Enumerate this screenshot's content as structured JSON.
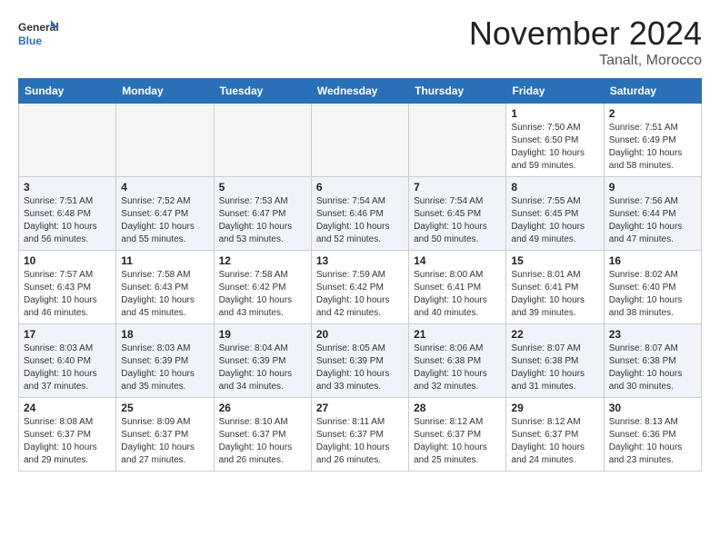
{
  "header": {
    "logo_general": "General",
    "logo_blue": "Blue",
    "month": "November 2024",
    "location": "Tanalt, Morocco"
  },
  "weekdays": [
    "Sunday",
    "Monday",
    "Tuesday",
    "Wednesday",
    "Thursday",
    "Friday",
    "Saturday"
  ],
  "weeks": [
    [
      {
        "day": "",
        "info": ""
      },
      {
        "day": "",
        "info": ""
      },
      {
        "day": "",
        "info": ""
      },
      {
        "day": "",
        "info": ""
      },
      {
        "day": "",
        "info": ""
      },
      {
        "day": "1",
        "info": "Sunrise: 7:50 AM\nSunset: 6:50 PM\nDaylight: 10 hours and 59 minutes."
      },
      {
        "day": "2",
        "info": "Sunrise: 7:51 AM\nSunset: 6:49 PM\nDaylight: 10 hours and 58 minutes."
      }
    ],
    [
      {
        "day": "3",
        "info": "Sunrise: 7:51 AM\nSunset: 6:48 PM\nDaylight: 10 hours and 56 minutes."
      },
      {
        "day": "4",
        "info": "Sunrise: 7:52 AM\nSunset: 6:47 PM\nDaylight: 10 hours and 55 minutes."
      },
      {
        "day": "5",
        "info": "Sunrise: 7:53 AM\nSunset: 6:47 PM\nDaylight: 10 hours and 53 minutes."
      },
      {
        "day": "6",
        "info": "Sunrise: 7:54 AM\nSunset: 6:46 PM\nDaylight: 10 hours and 52 minutes."
      },
      {
        "day": "7",
        "info": "Sunrise: 7:54 AM\nSunset: 6:45 PM\nDaylight: 10 hours and 50 minutes."
      },
      {
        "day": "8",
        "info": "Sunrise: 7:55 AM\nSunset: 6:45 PM\nDaylight: 10 hours and 49 minutes."
      },
      {
        "day": "9",
        "info": "Sunrise: 7:56 AM\nSunset: 6:44 PM\nDaylight: 10 hours and 47 minutes."
      }
    ],
    [
      {
        "day": "10",
        "info": "Sunrise: 7:57 AM\nSunset: 6:43 PM\nDaylight: 10 hours and 46 minutes."
      },
      {
        "day": "11",
        "info": "Sunrise: 7:58 AM\nSunset: 6:43 PM\nDaylight: 10 hours and 45 minutes."
      },
      {
        "day": "12",
        "info": "Sunrise: 7:58 AM\nSunset: 6:42 PM\nDaylight: 10 hours and 43 minutes."
      },
      {
        "day": "13",
        "info": "Sunrise: 7:59 AM\nSunset: 6:42 PM\nDaylight: 10 hours and 42 minutes."
      },
      {
        "day": "14",
        "info": "Sunrise: 8:00 AM\nSunset: 6:41 PM\nDaylight: 10 hours and 40 minutes."
      },
      {
        "day": "15",
        "info": "Sunrise: 8:01 AM\nSunset: 6:41 PM\nDaylight: 10 hours and 39 minutes."
      },
      {
        "day": "16",
        "info": "Sunrise: 8:02 AM\nSunset: 6:40 PM\nDaylight: 10 hours and 38 minutes."
      }
    ],
    [
      {
        "day": "17",
        "info": "Sunrise: 8:03 AM\nSunset: 6:40 PM\nDaylight: 10 hours and 37 minutes."
      },
      {
        "day": "18",
        "info": "Sunrise: 8:03 AM\nSunset: 6:39 PM\nDaylight: 10 hours and 35 minutes."
      },
      {
        "day": "19",
        "info": "Sunrise: 8:04 AM\nSunset: 6:39 PM\nDaylight: 10 hours and 34 minutes."
      },
      {
        "day": "20",
        "info": "Sunrise: 8:05 AM\nSunset: 6:39 PM\nDaylight: 10 hours and 33 minutes."
      },
      {
        "day": "21",
        "info": "Sunrise: 8:06 AM\nSunset: 6:38 PM\nDaylight: 10 hours and 32 minutes."
      },
      {
        "day": "22",
        "info": "Sunrise: 8:07 AM\nSunset: 6:38 PM\nDaylight: 10 hours and 31 minutes."
      },
      {
        "day": "23",
        "info": "Sunrise: 8:07 AM\nSunset: 6:38 PM\nDaylight: 10 hours and 30 minutes."
      }
    ],
    [
      {
        "day": "24",
        "info": "Sunrise: 8:08 AM\nSunset: 6:37 PM\nDaylight: 10 hours and 29 minutes."
      },
      {
        "day": "25",
        "info": "Sunrise: 8:09 AM\nSunset: 6:37 PM\nDaylight: 10 hours and 27 minutes."
      },
      {
        "day": "26",
        "info": "Sunrise: 8:10 AM\nSunset: 6:37 PM\nDaylight: 10 hours and 26 minutes."
      },
      {
        "day": "27",
        "info": "Sunrise: 8:11 AM\nSunset: 6:37 PM\nDaylight: 10 hours and 26 minutes."
      },
      {
        "day": "28",
        "info": "Sunrise: 8:12 AM\nSunset: 6:37 PM\nDaylight: 10 hours and 25 minutes."
      },
      {
        "day": "29",
        "info": "Sunrise: 8:12 AM\nSunset: 6:37 PM\nDaylight: 10 hours and 24 minutes."
      },
      {
        "day": "30",
        "info": "Sunrise: 8:13 AM\nSunset: 6:36 PM\nDaylight: 10 hours and 23 minutes."
      }
    ]
  ]
}
